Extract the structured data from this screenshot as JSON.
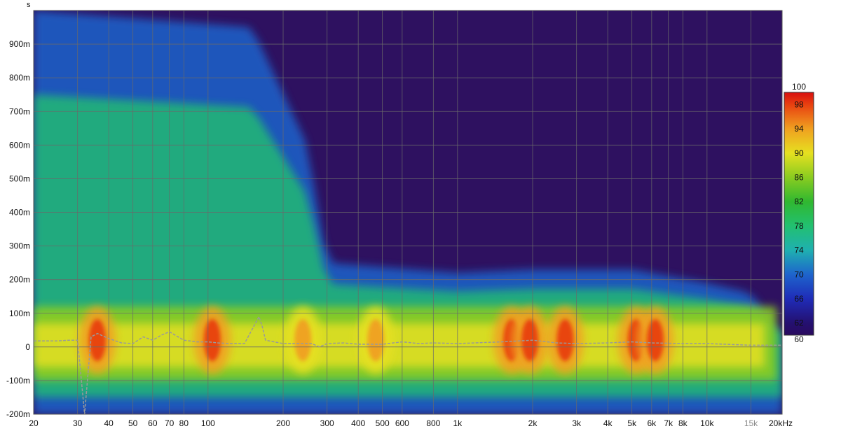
{
  "chart_data": {
    "type": "heatmap",
    "title": "",
    "xlabel": "",
    "ylabel": "",
    "y_unit_label": "s",
    "x_unit_suffix": "kHz",
    "x_scale": "log",
    "x_range": [
      20,
      20000
    ],
    "y_range": [
      -0.2,
      1.0
    ],
    "grid": true,
    "x_ticks": [
      {
        "value": 20,
        "label": "20"
      },
      {
        "value": 30,
        "label": "30"
      },
      {
        "value": 40,
        "label": "40"
      },
      {
        "value": 50,
        "label": "50"
      },
      {
        "value": 60,
        "label": "60"
      },
      {
        "value": 70,
        "label": "70"
      },
      {
        "value": 80,
        "label": "80"
      },
      {
        "value": 100,
        "label": "100"
      },
      {
        "value": 200,
        "label": "200"
      },
      {
        "value": 300,
        "label": "300"
      },
      {
        "value": 400,
        "label": "400"
      },
      {
        "value": 500,
        "label": "500"
      },
      {
        "value": 600,
        "label": "600"
      },
      {
        "value": 800,
        "label": "800"
      },
      {
        "value": 1000,
        "label": "1k"
      },
      {
        "value": 2000,
        "label": "2k"
      },
      {
        "value": 3000,
        "label": "3k"
      },
      {
        "value": 4000,
        "label": "4k"
      },
      {
        "value": 5000,
        "label": "5k"
      },
      {
        "value": 6000,
        "label": "6k"
      },
      {
        "value": 7000,
        "label": "7k"
      },
      {
        "value": 8000,
        "label": "8k"
      },
      {
        "value": 10000,
        "label": "10k"
      },
      {
        "value": 15000,
        "label": "15k",
        "muted": true
      },
      {
        "value": 20000,
        "label": "20kHz"
      }
    ],
    "y_ticks": [
      {
        "value": 0.9,
        "label": "900m"
      },
      {
        "value": 0.8,
        "label": "800m"
      },
      {
        "value": 0.7,
        "label": "700m"
      },
      {
        "value": 0.6,
        "label": "600m"
      },
      {
        "value": 0.5,
        "label": "500m"
      },
      {
        "value": 0.4,
        "label": "400m"
      },
      {
        "value": 0.3,
        "label": "300m"
      },
      {
        "value": 0.2,
        "label": "200m"
      },
      {
        "value": 0.1,
        "label": "100m"
      },
      {
        "value": 0.0,
        "label": "0"
      },
      {
        "value": -0.1,
        "label": "-100m"
      },
      {
        "value": -0.2,
        "label": "-200m"
      }
    ],
    "colorbar": {
      "range": [
        60,
        100
      ],
      "ticks": [
        {
          "value": 100,
          "label": "100"
        },
        {
          "value": 98,
          "label": "98"
        },
        {
          "value": 94,
          "label": "94"
        },
        {
          "value": 90,
          "label": "90"
        },
        {
          "value": 86,
          "label": "86"
        },
        {
          "value": 82,
          "label": "82"
        },
        {
          "value": 78,
          "label": "78"
        },
        {
          "value": 74,
          "label": "74"
        },
        {
          "value": 70,
          "label": "70"
        },
        {
          "value": 66,
          "label": "66"
        },
        {
          "value": 62,
          "label": "62"
        },
        {
          "value": 60,
          "label": "60"
        }
      ],
      "stops": [
        {
          "value": 60,
          "color": "#2a0a5e"
        },
        {
          "value": 62,
          "color": "#241070"
        },
        {
          "value": 66,
          "color": "#1f2cb8"
        },
        {
          "value": 70,
          "color": "#1e64cc"
        },
        {
          "value": 74,
          "color": "#1fb0b0"
        },
        {
          "value": 78,
          "color": "#22c070"
        },
        {
          "value": 82,
          "color": "#30b830"
        },
        {
          "value": 86,
          "color": "#8acc20"
        },
        {
          "value": 90,
          "color": "#e6e020"
        },
        {
          "value": 94,
          "color": "#f0a020"
        },
        {
          "value": 98,
          "color": "#e84010"
        },
        {
          "value": 100,
          "color": "#d81010"
        }
      ]
    },
    "background_color": "#2e1160",
    "hot_spots": [
      {
        "freq": 36,
        "time": 0.02,
        "level": 98
      },
      {
        "freq": 104,
        "time": 0.02,
        "level": 98
      },
      {
        "freq": 240,
        "time": 0.02,
        "level": 92
      },
      {
        "freq": 470,
        "time": 0.02,
        "level": 94
      },
      {
        "freq": 1650,
        "time": 0.02,
        "level": 98
      },
      {
        "freq": 1950,
        "time": 0.02,
        "level": 97
      },
      {
        "freq": 2700,
        "time": 0.02,
        "level": 96
      },
      {
        "freq": 5200,
        "time": 0.02,
        "level": 96
      },
      {
        "freq": 6200,
        "time": 0.02,
        "level": 95
      }
    ],
    "decay_envelope": [
      {
        "freq": 20,
        "time": 1.0
      },
      {
        "freq": 150,
        "time": 0.95
      },
      {
        "freq": 250,
        "time": 0.6
      },
      {
        "freq": 300,
        "time": 0.25
      },
      {
        "freq": 1000,
        "time": 0.22
      },
      {
        "freq": 2000,
        "time": 0.23
      },
      {
        "freq": 5000,
        "time": 0.23
      },
      {
        "freq": 10000,
        "time": 0.19
      },
      {
        "freq": 15000,
        "time": 0.16
      },
      {
        "freq": 20000,
        "time": 0.03
      }
    ],
    "series": [
      {
        "values_freq": [
          20,
          25,
          28,
          30,
          32,
          34,
          36,
          40,
          45,
          50,
          55,
          60,
          65,
          70,
          80,
          90,
          100,
          110,
          120,
          140,
          160,
          165,
          170,
          200,
          230,
          260,
          280,
          300,
          350,
          400,
          500,
          600,
          700,
          800,
          1000,
          1500,
          2000,
          2500,
          3000,
          4000,
          5000,
          6000,
          8000,
          10000,
          15000,
          20000
        ],
        "values_time": [
          0.018,
          0.018,
          0.02,
          0.02,
          -0.2,
          0.03,
          0.04,
          0.025,
          0.012,
          0.01,
          0.03,
          0.02,
          0.035,
          0.045,
          0.02,
          0.015,
          0.015,
          0.012,
          0.01,
          0.01,
          0.09,
          0.06,
          0.02,
          0.01,
          0.01,
          0.01,
          0.0,
          0.01,
          0.012,
          0.008,
          0.008,
          0.015,
          0.01,
          0.012,
          0.01,
          0.015,
          0.02,
          0.012,
          0.01,
          0.012,
          0.015,
          0.012,
          0.01,
          0.01,
          0.005,
          0.005
        ]
      }
    ]
  }
}
